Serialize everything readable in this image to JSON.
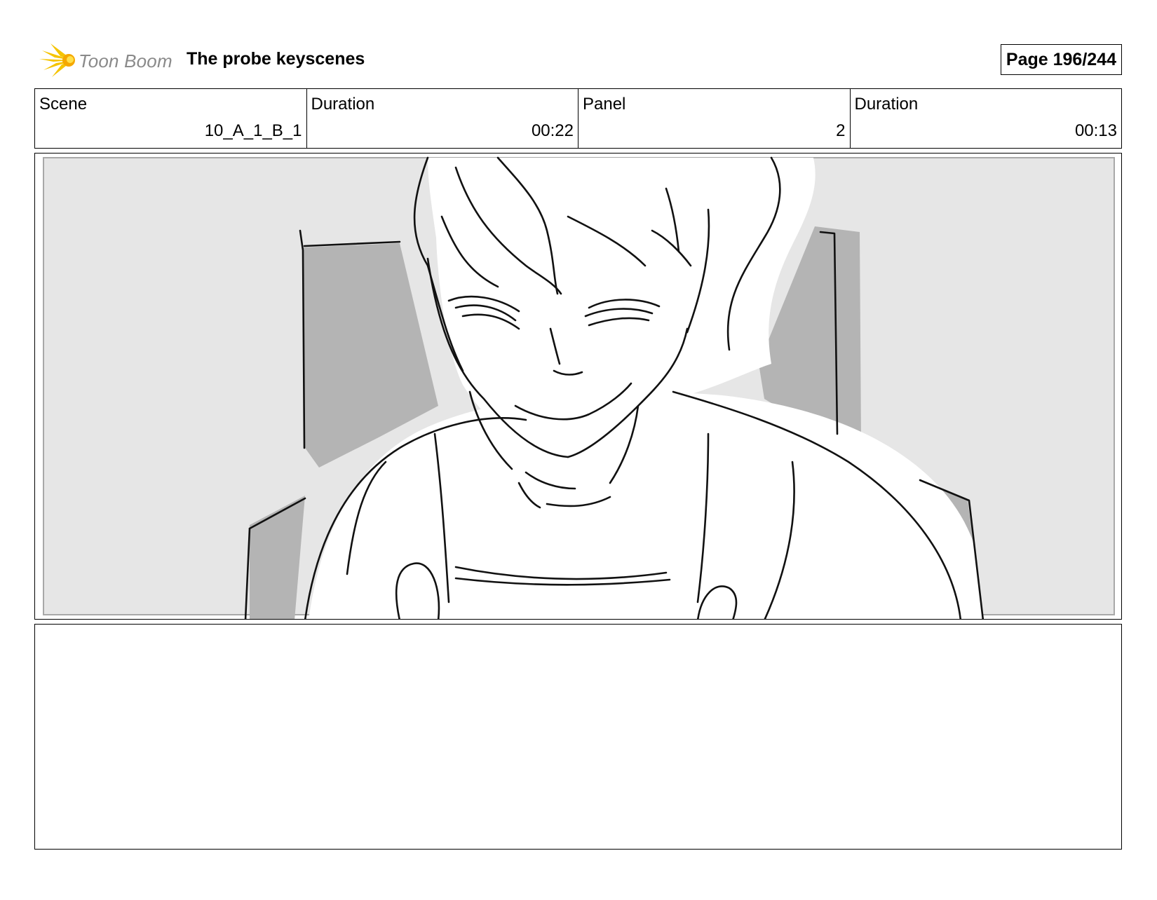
{
  "header": {
    "logo_text": "Toon Boom",
    "title": "The probe keyscenes",
    "page": "Page 196/244"
  },
  "info": {
    "scene_label": "Scene",
    "scene_value": "10_A_1_B_1",
    "scene_duration_label": "Duration",
    "scene_duration_value": "00:22",
    "panel_label": "Panel",
    "panel_value": "2",
    "panel_duration_label": "Duration",
    "panel_duration_value": "00:13"
  },
  "panel_image": {
    "icon": "storyboard-sketch-smiling-character-icon"
  },
  "notes": {}
}
